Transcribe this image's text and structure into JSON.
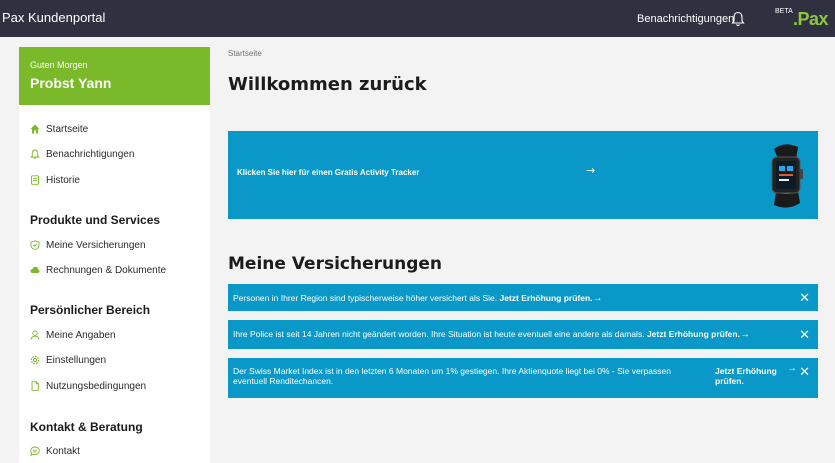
{
  "header": {
    "app_title": "Pax Kundenportal",
    "notifications_label": "Benachrichtigungen",
    "beta_label": "BETA",
    "logo_text": ".Pax"
  },
  "sidebar": {
    "greeting": "Guten Morgen",
    "user_name": "Probst Yann",
    "nav": [
      {
        "label": "Startseite",
        "icon": "home-icon"
      },
      {
        "label": "Benachrichtigungen",
        "icon": "bell-icon"
      },
      {
        "label": "Historie",
        "icon": "document-icon"
      }
    ],
    "sections": [
      {
        "title": "Produkte und Services",
        "items": [
          {
            "label": "Meine Versicherungen",
            "icon": "shield-icon"
          },
          {
            "label": "Rechnungen & Dokumente",
            "icon": "cloud-icon"
          }
        ]
      },
      {
        "title": "Persönlicher Bereich",
        "items": [
          {
            "label": "Meine Angaben",
            "icon": "user-icon"
          },
          {
            "label": "Einstellungen",
            "icon": "gear-icon"
          },
          {
            "label": "Nutzungsbedingungen",
            "icon": "file-icon"
          }
        ]
      },
      {
        "title": "Kontakt & Beratung",
        "items": [
          {
            "label": "Kontakt",
            "icon": "chat-icon"
          }
        ]
      }
    ]
  },
  "main": {
    "breadcrumb": "Startseite",
    "title": "Willkommen zurück",
    "banner_text": "Klicken Sie hier für einen Gratis Activity Tracker",
    "banner_arrow": "→",
    "section_heading": "Meine Versicherungen",
    "notices": [
      {
        "text": "Personen in Ihrer Region sind typischerweise höher versichert als Sie.",
        "link": "Jetzt Erhöhung prüfen.",
        "arrow": "→",
        "close": "✕"
      },
      {
        "text": "Ihre Police ist seit 14 Jahren nicht geändert worden. Ihre Situation ist heute eventuell eine andere als damals.",
        "link": "Jetzt Erhöhung prüfen.",
        "arrow": "→",
        "close": "✕"
      },
      {
        "text_line1": "Der Swiss Market Index ist in den letzten 6 Monaten um 1% gestiegen. Ihre Aktienquote liegt bei 0% - Sie verpassen",
        "text_line2": "eventuell Renditechancen.",
        "link_line1": "Jetzt Erhöhung",
        "link_line2": "prüfen.",
        "arrow": "→",
        "close": "✕"
      }
    ]
  },
  "colors": {
    "topbar": "#2f3140",
    "accent_green": "#7ab929",
    "logo_green": "#8dc63f",
    "brand_blue": "#0a98c8"
  }
}
